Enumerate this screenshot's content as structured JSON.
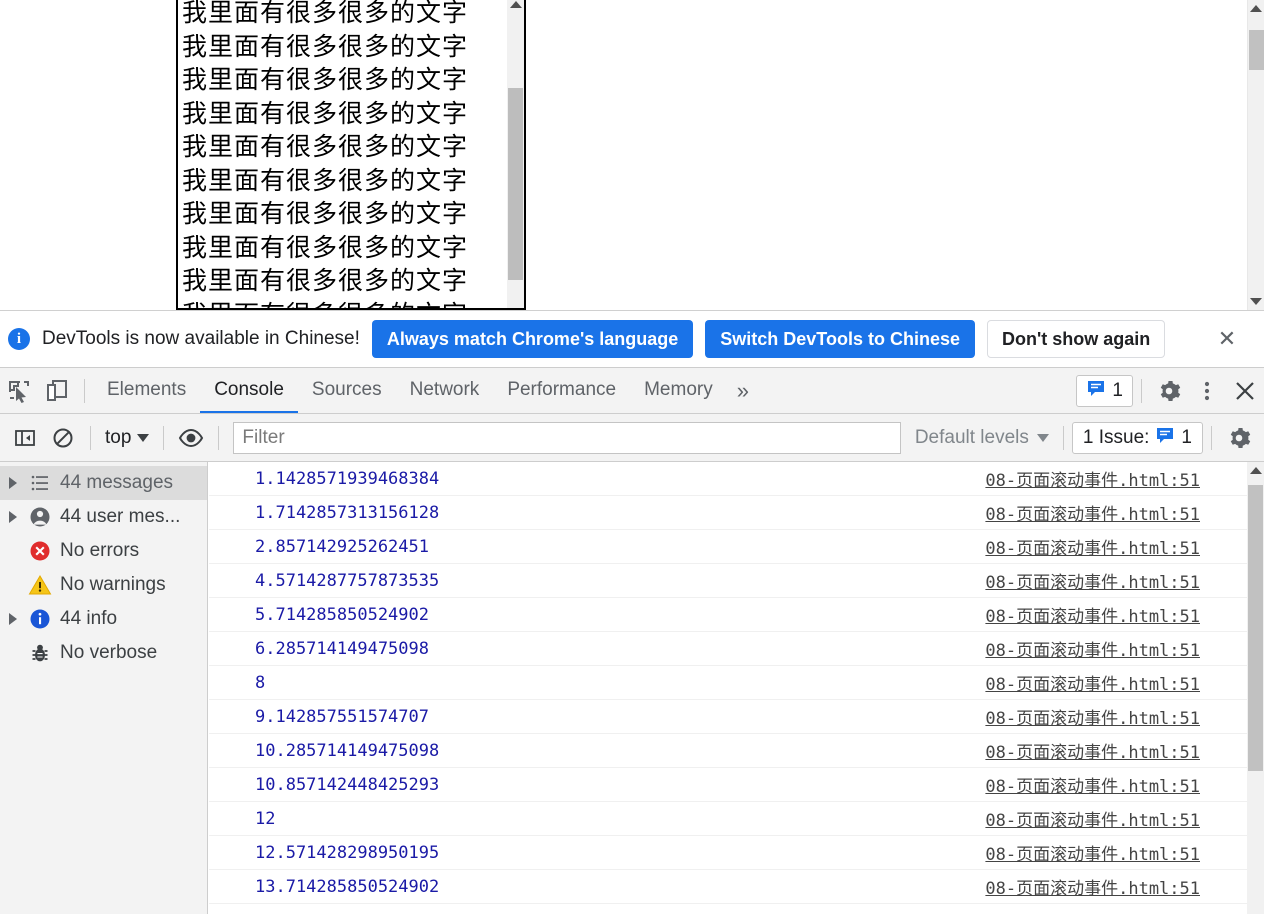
{
  "page": {
    "text_box": {
      "line_text": "我里面有很多很多的文字",
      "line_count": 11
    },
    "scrollbar": {
      "up_arrow": "scroll-up-arrow",
      "down_arrow": "scroll-down-arrow"
    }
  },
  "language_banner": {
    "icon": "info-icon",
    "icon_glyph": "i",
    "message": "DevTools is now available in Chinese!",
    "primary_button": "Always match Chrome's language",
    "secondary_button": "Switch DevTools to Chinese",
    "dismiss_button": "Don't show again",
    "close_glyph": "✕",
    "accent_color": "#1a73e8"
  },
  "devtools": {
    "toolbar_icons": [
      {
        "name": "inspect-element-icon"
      },
      {
        "name": "device-toolbar-icon"
      }
    ],
    "tabs": [
      {
        "label": "Elements",
        "active": false
      },
      {
        "label": "Console",
        "active": true
      },
      {
        "label": "Sources",
        "active": false
      },
      {
        "label": "Network",
        "active": false
      },
      {
        "label": "Performance",
        "active": false
      },
      {
        "label": "Memory",
        "active": false
      }
    ],
    "overflow_glyph": "»",
    "issues_badge": {
      "count": "1",
      "icon": "issue-message-icon"
    },
    "settings_glyph": "⚙",
    "more_glyph": "⋮",
    "close_glyph": "✕",
    "active_tab_color": "#1a73e8"
  },
  "console_toolbar": {
    "sidebar_toggle_icon": "console-sidebar-toggle-icon",
    "clear_console_icon": "clear-console-icon",
    "context": "top",
    "eye_icon": "live-expression-icon",
    "filter_placeholder": "Filter",
    "filter_value": "",
    "levels": "Default levels",
    "issues": "1 Issue:",
    "issues_count": "1",
    "settings_glyph": "⚙"
  },
  "console_sidebar": [
    {
      "label": "44 messages",
      "icon": "list-icon",
      "expandable": true,
      "selected": true
    },
    {
      "label": "44 user mes...",
      "icon": "user-icon",
      "expandable": true,
      "selected": false
    },
    {
      "label": "No errors",
      "icon": "error-icon",
      "expandable": false,
      "selected": false
    },
    {
      "label": "No warnings",
      "icon": "warning-icon",
      "expandable": false,
      "selected": false
    },
    {
      "label": "44 info",
      "icon": "info-icon",
      "expandable": true,
      "selected": false
    },
    {
      "label": "No verbose",
      "icon": "verbose-bug-icon",
      "expandable": false,
      "selected": false
    }
  ],
  "console_rows": [
    {
      "value": "1.1428571939468384",
      "source": "08-页面滚动事件.html:51"
    },
    {
      "value": "1.7142857313156128",
      "source": "08-页面滚动事件.html:51"
    },
    {
      "value": "2.857142925262451",
      "source": "08-页面滚动事件.html:51"
    },
    {
      "value": "4.5714287757873535",
      "source": "08-页面滚动事件.html:51"
    },
    {
      "value": "5.714285850524902",
      "source": "08-页面滚动事件.html:51"
    },
    {
      "value": "6.285714149475098",
      "source": "08-页面滚动事件.html:51"
    },
    {
      "value": "8",
      "source": "08-页面滚动事件.html:51"
    },
    {
      "value": "9.142857551574707",
      "source": "08-页面滚动事件.html:51"
    },
    {
      "value": "10.285714149475098",
      "source": "08-页面滚动事件.html:51"
    },
    {
      "value": "10.857142448425293",
      "source": "08-页面滚动事件.html:51"
    },
    {
      "value": "12",
      "source": "08-页面滚动事件.html:51"
    },
    {
      "value": "12.571428298950195",
      "source": "08-页面滚动事件.html:51"
    },
    {
      "value": "13.714285850524902",
      "source": "08-页面滚动事件.html:51"
    }
  ]
}
